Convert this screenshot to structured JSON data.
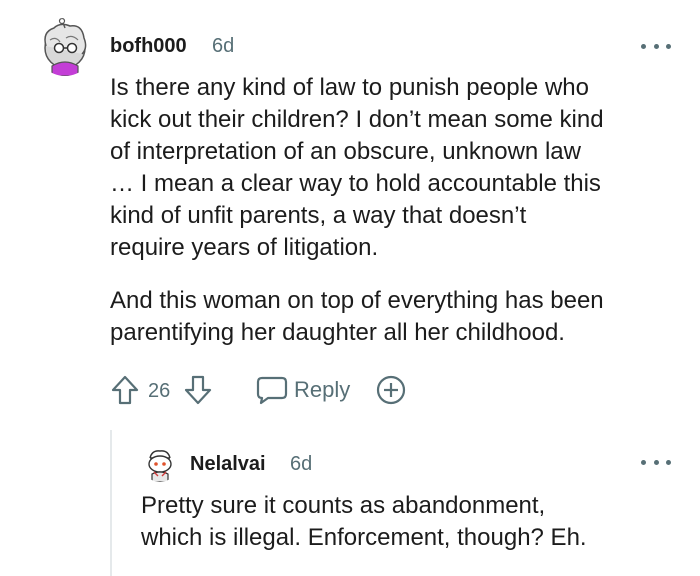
{
  "comment": {
    "author": "bofh000",
    "age": "6d",
    "paragraphs": [
      "Is there any kind of law to punish people who\nkick out their children? I don’t mean some kind\nof interpretation of an obscure, unknown law\n… I mean a clear way to hold accountable this\nkind of unfit parents, a way that doesn’t\nrequire years of litigation.",
      "And this woman on top of everything has been\nparentifying her daughter all her childhood."
    ],
    "score": "26",
    "reply_label": "Reply",
    "icons": {
      "upvote": "arrow-up-icon",
      "downvote": "arrow-down-icon",
      "reply": "speech-bubble-icon",
      "award": "plus-circle-icon",
      "more": "ellipsis-icon"
    }
  },
  "reply": {
    "author": "Nelalvai",
    "age": "6d",
    "text": "Pretty sure it counts as abandonment,\nwhich is illegal. Enforcement, though? Eh."
  },
  "colors": {
    "text": "#1c1c1c",
    "meta": "#576f76",
    "thread_line": "#e5e9eb"
  }
}
